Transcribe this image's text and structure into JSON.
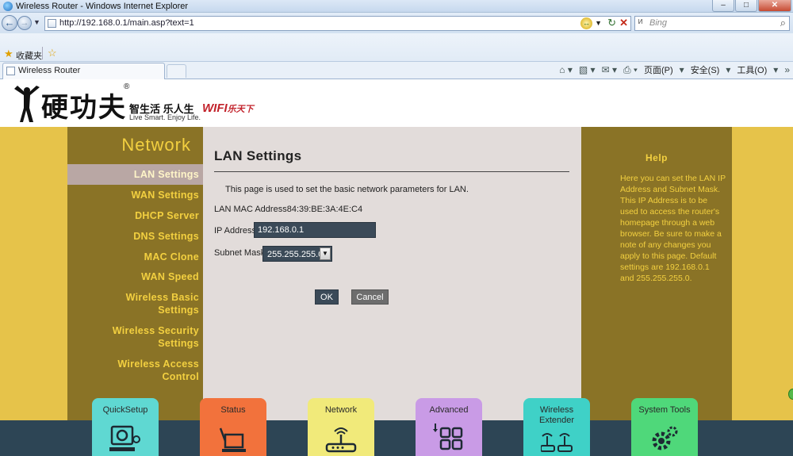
{
  "window": {
    "title": "Wireless Router - Windows Internet Explorer"
  },
  "browser": {
    "url": "http://192.168.0.1/main.asp?text=1",
    "search_placeholder": "Bing",
    "favorites_label": "收藏夹",
    "tab_label": "Wireless Router",
    "cmd": {
      "page": "页面(P)",
      "safety": "安全(S)",
      "tools": "工具(O)"
    }
  },
  "brand": {
    "name_cn": "硬功夫",
    "registered": "®",
    "slogan_cn": "智生活 乐人生",
    "slogan_en": "Live Smart. Enjoy Life.",
    "wifi_text": "WIFI",
    "wifi_cn": "乐天下"
  },
  "sidebar": {
    "title": "Network",
    "items": [
      {
        "line1": "LAN Settings",
        "line2": ""
      },
      {
        "line1": "WAN Settings",
        "line2": ""
      },
      {
        "line1": "DHCP Server",
        "line2": ""
      },
      {
        "line1": "DNS Settings",
        "line2": ""
      },
      {
        "line1": "MAC Clone",
        "line2": ""
      },
      {
        "line1": "WAN Speed",
        "line2": ""
      },
      {
        "line1": "Wireless Basic",
        "line2": "Settings"
      },
      {
        "line1": "Wireless Security",
        "line2": "Settings"
      },
      {
        "line1": "Wireless Access",
        "line2": "Control"
      }
    ]
  },
  "content": {
    "title": "LAN Settings",
    "description": "This page is used to set the basic network parameters for LAN.",
    "mac_label": "LAN MAC Address",
    "mac_value": "84:39:BE:3A:4E:C4",
    "ip_label": "IP Address",
    "ip_value": "192.168.0.1",
    "mask_label": "Subnet Mask",
    "mask_value": "255.255.255.0",
    "ok_label": "OK",
    "cancel_label": "Cancel"
  },
  "help": {
    "title": "Help",
    "text": "Here you can set the LAN IP Address and Subnet Mask. This IP Address is to be used to access the router's homepage through a web browser. Be sure to make a note of any changes you apply to this page. Default settings are 192.168.0.1 and 255.255.255.0."
  },
  "tiles": [
    {
      "label": "QuickSetup",
      "icon": "quicksetup-icon"
    },
    {
      "label": "Status",
      "icon": "laptop-icon"
    },
    {
      "label": "Network",
      "icon": "router-icon"
    },
    {
      "label": "Advanced",
      "icon": "grid-icon"
    },
    {
      "label": "Wireless Extender",
      "icon": "extender-icon"
    },
    {
      "label": "System Tools",
      "icon": "gear-icon"
    }
  ]
}
